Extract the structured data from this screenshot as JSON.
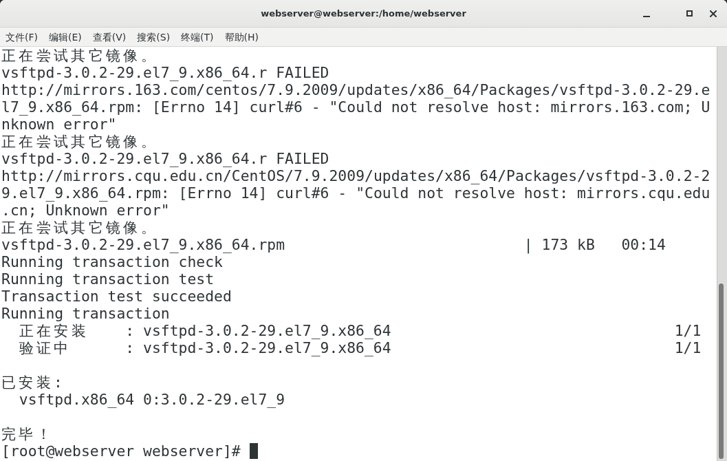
{
  "window": {
    "title": "webserver@webserver:/home/webserver"
  },
  "menu": [
    "文件(F)",
    "编辑(E)",
    "查看(V)",
    "搜索(S)",
    "终端(T)",
    "帮助(H)"
  ],
  "terminal": {
    "lines": [
      {
        "kind": "text",
        "text": "正在尝试其它镜像。"
      },
      {
        "kind": "text",
        "text": "vsftpd-3.0.2-29.el7_9.x86_64.r FAILED"
      },
      {
        "kind": "text",
        "text": "http://mirrors.163.com/centos/7.9.2009/updates/x86_64/Packages/vsftpd-3.0.2-29.e"
      },
      {
        "kind": "text",
        "text": "l7_9.x86_64.rpm: [Errno 14] curl#6 - \"Could not resolve host: mirrors.163.com; U"
      },
      {
        "kind": "text",
        "text": "nknown error\""
      },
      {
        "kind": "text",
        "text": "正在尝试其它镜像。"
      },
      {
        "kind": "text",
        "text": "vsftpd-3.0.2-29.el7_9.x86_64.r FAILED"
      },
      {
        "kind": "text",
        "text": "http://mirrors.cqu.edu.cn/CentOS/7.9.2009/updates/x86_64/Packages/vsftpd-3.0.2-2"
      },
      {
        "kind": "text",
        "text": "9.el7_9.x86_64.rpm: [Errno 14] curl#6 - \"Could not resolve host: mirrors.cqu.edu"
      },
      {
        "kind": "text",
        "text": ".cn; Unknown error\""
      },
      {
        "kind": "text",
        "text": "正在尝试其它镜像。"
      },
      {
        "kind": "download",
        "file": "vsftpd-3.0.2-29.el7_9.x86_64.rpm",
        "separator": "|",
        "size": "173 kB",
        "time": "00:14"
      },
      {
        "kind": "text",
        "text": "Running transaction check"
      },
      {
        "kind": "text",
        "text": "Running transaction test"
      },
      {
        "kind": "text",
        "text": "Transaction test succeeded"
      },
      {
        "kind": "text",
        "text": "Running transaction"
      },
      {
        "kind": "step",
        "action": "正在安装",
        "separator": ":",
        "package": "vsftpd-3.0.2-29.el7_9.x86_64",
        "count": "1/1"
      },
      {
        "kind": "step",
        "action": "验证中",
        "separator": ":",
        "package": "vsftpd-3.0.2-29.el7_9.x86_64",
        "count": "1/1"
      },
      {
        "kind": "blank"
      },
      {
        "kind": "text",
        "text": "已安装:"
      },
      {
        "kind": "text",
        "text": "  vsftpd.x86_64 0:3.0.2-29.el7_9"
      },
      {
        "kind": "blank"
      },
      {
        "kind": "text",
        "text": "完毕！"
      },
      {
        "kind": "prompt",
        "text": "[root@webserver webserver]#",
        "cursor": true
      }
    ]
  }
}
